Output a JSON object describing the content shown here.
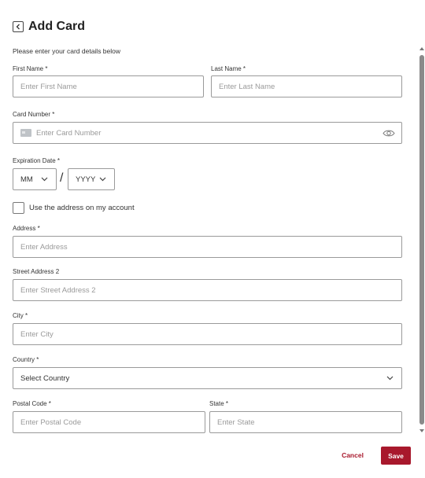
{
  "header": {
    "title": "Add Card"
  },
  "form": {
    "subtitle": "Please enter your card details below",
    "first_name": {
      "label": "First Name *",
      "placeholder": "Enter First Name"
    },
    "last_name": {
      "label": "Last Name *",
      "placeholder": "Enter Last Name"
    },
    "card_number": {
      "label": "Card Number *",
      "placeholder": "Enter Card Number"
    },
    "expiration": {
      "label": "Expiration Date *",
      "month": "MM",
      "year": "YYYY",
      "separator": "/"
    },
    "use_account_address": {
      "label": "Use the address on my account",
      "checked": false
    },
    "address": {
      "label": "Address *",
      "placeholder": "Enter Address"
    },
    "street2": {
      "label": "Street Address 2",
      "placeholder": "Enter Street Address 2"
    },
    "city": {
      "label": "City *",
      "placeholder": "Enter City"
    },
    "country": {
      "label": "Country *",
      "value": "Select Country"
    },
    "postal": {
      "label": "Postal Code *",
      "placeholder": "Enter Postal Code"
    },
    "state": {
      "label": "State *",
      "placeholder": "Enter State"
    }
  },
  "footer": {
    "cancel_label": "Cancel",
    "save_label": "Save"
  },
  "colors": {
    "accent": "#a8182c",
    "border": "#9a9a9a",
    "placeholder": "#9a9a9a"
  }
}
